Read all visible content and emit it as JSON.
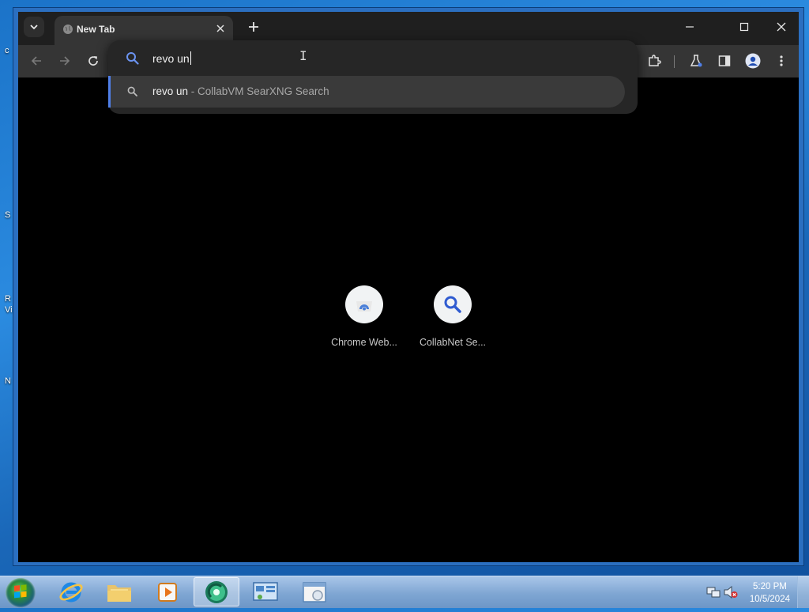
{
  "desktop": {
    "fragments": [
      "c",
      "S",
      "R",
      "Vi",
      "N"
    ]
  },
  "browser": {
    "tab": {
      "title": "New Tab"
    },
    "omnibox": {
      "query": "revo un",
      "suggestion": {
        "query": "revo un",
        "engine_suffix": " - CollabVM SearXNG Search"
      }
    },
    "shortcuts": [
      {
        "label": "Chrome Web...",
        "icon": "chrome-web-store-icon"
      },
      {
        "label": "CollabNet Se...",
        "icon": "search-icon"
      }
    ]
  },
  "taskbar": {
    "time": "5:20 PM",
    "date": "10/5/2024",
    "items": [
      "internet-explorer-icon",
      "file-explorer-icon",
      "media-player-icon",
      "chrome-icon",
      "control-panel-icon",
      "program-window-icon"
    ]
  },
  "colors": {
    "accent": "#4f7fe8",
    "page_bg": "#000000",
    "chrome_dark": "#353535"
  }
}
